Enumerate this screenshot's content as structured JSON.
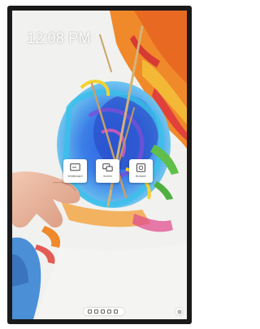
{
  "lock_screen": {
    "time": "12:08 PM"
  },
  "quick_actions": [
    {
      "label": "Whiteboard",
      "icon": "whiteboard-icon"
    },
    {
      "label": "Screen",
      "icon": "screen-share-icon"
    },
    {
      "label": "Browser",
      "icon": "browser-icon"
    }
  ],
  "taskbar": {
    "icons": [
      "home-icon",
      "window-icon",
      "apps-icon",
      "grid-icon",
      "files-icon"
    ]
  },
  "settings": {
    "icon": "gear-icon"
  },
  "colors": {
    "bezel": "#1a1a1a",
    "paint_blue": "#3f63d8",
    "paint_cyan": "#39b8e6",
    "paint_orange": "#f0892a",
    "paint_yellow": "#f3d230",
    "paint_red": "#e0413a",
    "paint_green": "#5fbf4a"
  }
}
